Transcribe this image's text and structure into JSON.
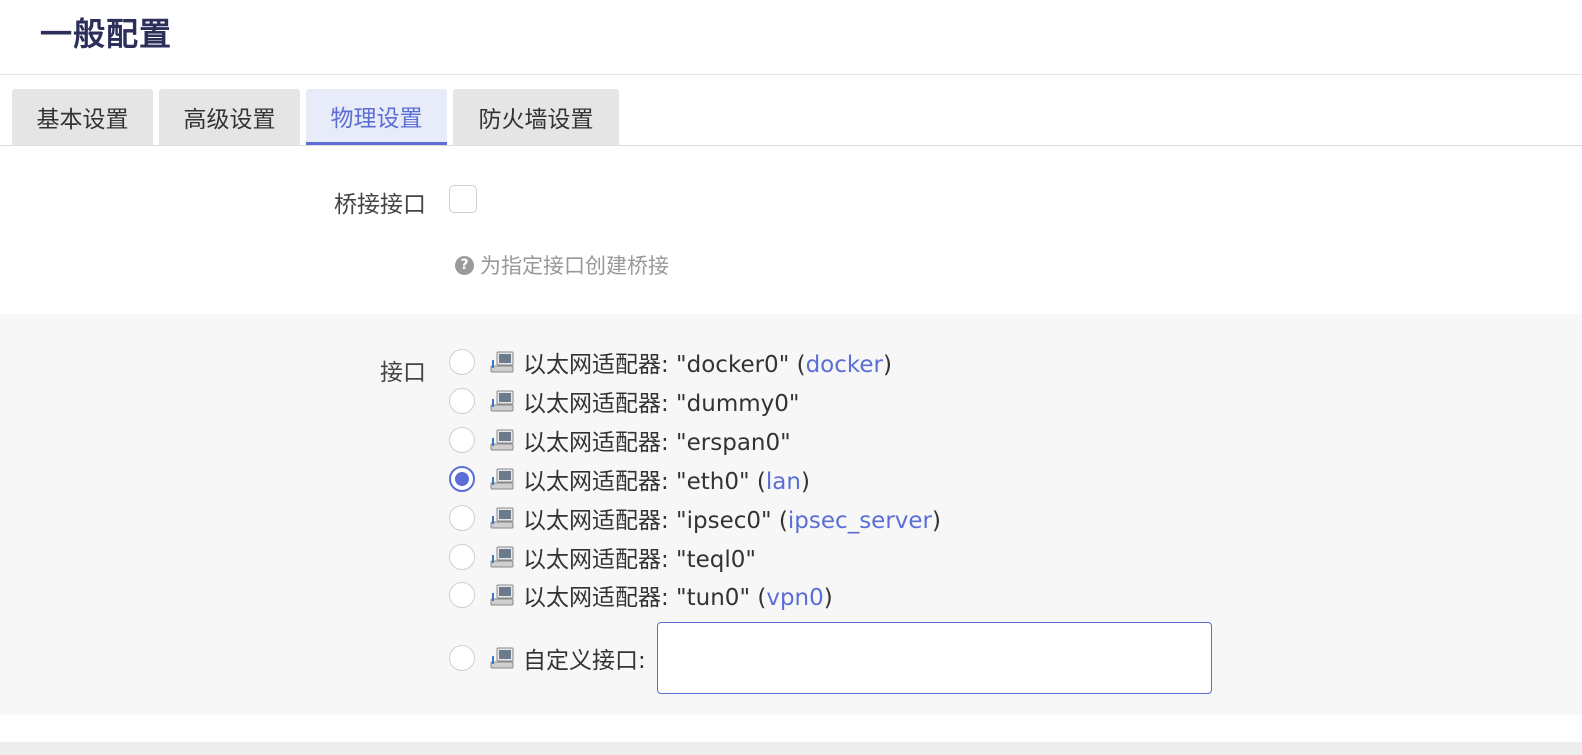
{
  "page": {
    "title": "一般配置"
  },
  "tabs": [
    {
      "label": "基本设置",
      "active": false
    },
    {
      "label": "高级设置",
      "active": false
    },
    {
      "label": "物理设置",
      "active": true
    },
    {
      "label": "防火墙设置",
      "active": false
    }
  ],
  "bridge": {
    "label": "桥接接口",
    "checked": false,
    "help_icon": "question-circle-icon",
    "help_text": "为指定接口创建桥接"
  },
  "interface": {
    "label": "接口",
    "options": [
      {
        "text": "以太网适配器: \"docker0\"",
        "network": "docker",
        "selected": false
      },
      {
        "text": "以太网适配器: \"dummy0\"",
        "network": "",
        "selected": false
      },
      {
        "text": "以太网适配器: \"erspan0\"",
        "network": "",
        "selected": false
      },
      {
        "text": "以太网适配器: \"eth0\"",
        "network": "lan",
        "selected": true
      },
      {
        "text": "以太网适配器: \"ipsec0\"",
        "network": "ipsec_server",
        "selected": false
      },
      {
        "text": "以太网适配器: \"teql0\"",
        "network": "",
        "selected": false
      },
      {
        "text": "以太网适配器: \"tun0\"",
        "network": "vpn0",
        "selected": false
      }
    ],
    "custom": {
      "label": "自定义接口:",
      "value": "",
      "selected": false
    },
    "option_icon": "ethernet-adapter-icon"
  },
  "colors": {
    "accent": "#5b6ed6",
    "title": "#2b2f5a",
    "section_bg": "#f7f7f7"
  }
}
